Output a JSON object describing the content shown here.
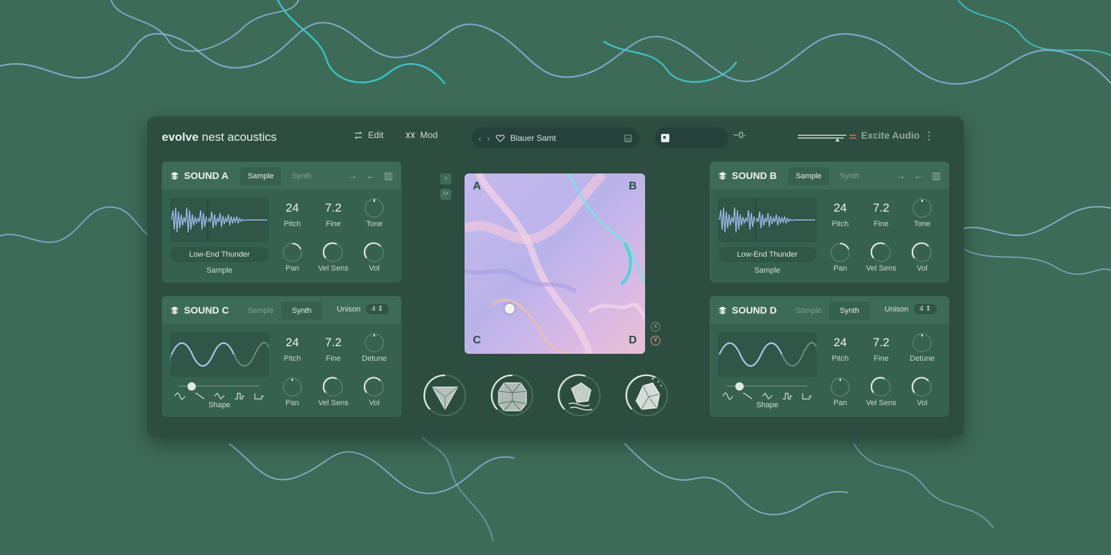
{
  "header": {
    "brand_bold": "evolve",
    "brand_rest": "nest acoustics",
    "edit_label": "Edit",
    "mod_label": "Mod",
    "preset_name": "Blauer Samt",
    "maker": "Excite Audio"
  },
  "sound_a": {
    "title": "SOUND A",
    "tab_sample": "Sample",
    "tab_synth": "Synth",
    "active_tab": "Sample",
    "sample_name": "Low-End Thunder",
    "source_label": "Sample",
    "pitch": "24",
    "pitch_label": "Pitch",
    "fine": "7.2",
    "fine_label": "Fine",
    "tone_label": "Tone",
    "pan_label": "Pan",
    "velsens_label": "Vel Sens",
    "vol_label": "Vol"
  },
  "sound_b": {
    "title": "SOUND B",
    "tab_sample": "Sample",
    "tab_synth": "Synth",
    "active_tab": "Sample",
    "sample_name": "Low-End Thunder",
    "source_label": "Sample",
    "pitch": "24",
    "pitch_label": "Pitch",
    "fine": "7.2",
    "fine_label": "Fine",
    "tone_label": "Tone",
    "pan_label": "Pan",
    "velsens_label": "Vel Sens",
    "vol_label": "Vol"
  },
  "sound_c": {
    "title": "SOUND C",
    "tab_sample": "Sample",
    "tab_synth": "Synth",
    "active_tab": "Synth",
    "unison_label": "Unison",
    "unison_value": "4",
    "source_label": "Shape",
    "pitch": "24",
    "pitch_label": "Pitch",
    "fine": "7.2",
    "fine_label": "Fine",
    "detune_label": "Detune",
    "pan_label": "Pan",
    "velsens_label": "Vel Sens",
    "vol_label": "Vol"
  },
  "sound_d": {
    "title": "SOUND D",
    "tab_sample": "Sample",
    "tab_synth": "Synth",
    "active_tab": "Synth",
    "unison_label": "Unison",
    "unison_value": "4",
    "source_label": "Shape",
    "pitch": "24",
    "pitch_label": "Pitch",
    "fine": "7.2",
    "fine_label": "Fine",
    "detune_label": "Detune",
    "pan_label": "Pan",
    "velsens_label": "Vel Sens",
    "vol_label": "Vol"
  },
  "xy_pad": {
    "corner_a": "A",
    "corner_b": "B",
    "corner_c": "C",
    "corner_d": "D",
    "x_label": "X",
    "y_label": "Y"
  },
  "side_icons": {
    "fx_label": "FX"
  },
  "colors": {
    "background": "#3d6b57",
    "panel": "#37614f",
    "plugin": "#2c4d40",
    "accent": "#dfe9e3"
  }
}
